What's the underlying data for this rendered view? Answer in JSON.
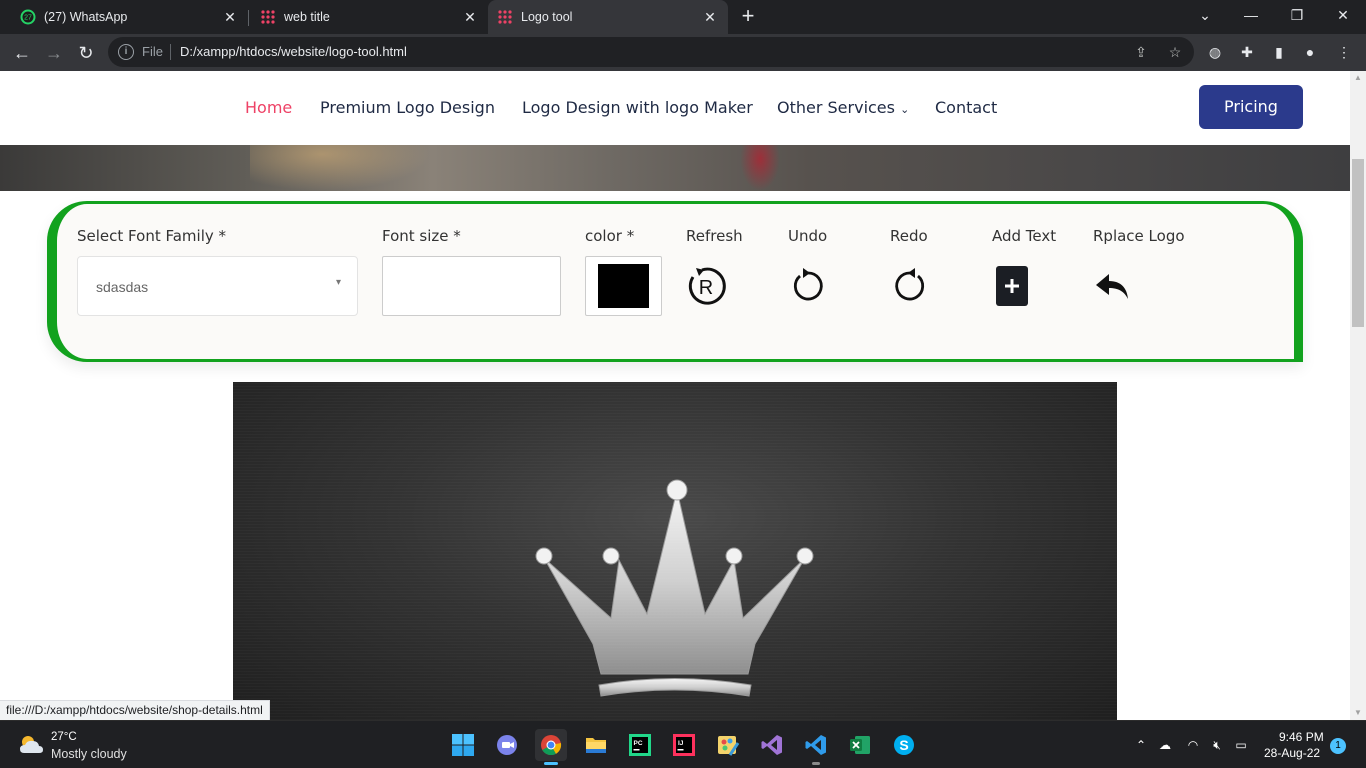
{
  "browser": {
    "tabs": [
      {
        "title": "(27) WhatsApp",
        "badge": "27",
        "active": false
      },
      {
        "title": "web title",
        "active": false
      },
      {
        "title": "Logo tool",
        "active": true
      }
    ],
    "omnibox": {
      "scheme_label": "File",
      "url": "D:/xampp/htdocs/website/logo-tool.html"
    },
    "status_url": "file:///D:/xampp/htdocs/website/shop-details.html"
  },
  "site_nav": {
    "links": [
      {
        "label": "Home",
        "active": true
      },
      {
        "label": "Premium Logo Design"
      },
      {
        "label": "Logo Design with logo Maker"
      },
      {
        "label": "Other Services",
        "has_dropdown": true
      },
      {
        "label": "Contact"
      }
    ],
    "cta": "Pricing",
    "active_color": "#ee4266",
    "cta_color": "#2b3a8c"
  },
  "tool_panel": {
    "border_color": "#12a21e",
    "font_family": {
      "label": "Select Font Family *",
      "value": "sdasdas"
    },
    "font_size": {
      "label": "Font size *",
      "value": ""
    },
    "color": {
      "label": "color *",
      "value": "#000000"
    },
    "actions": [
      {
        "label": "Refresh",
        "icon": "refresh-r-icon"
      },
      {
        "label": "Undo",
        "icon": "undo-icon"
      },
      {
        "label": "Redo",
        "icon": "redo-icon"
      },
      {
        "label": "Add Text",
        "icon": "plus-square-icon"
      },
      {
        "label": "Rplace Logo",
        "icon": "reply-arrow-icon"
      }
    ]
  },
  "canvas": {
    "logo": "crown-logo"
  },
  "taskbar": {
    "weather": {
      "temp": "27°C",
      "desc": "Mostly cloudy"
    },
    "clock": {
      "time": "9:46 PM",
      "date": "28-Aug-22"
    },
    "notifications": "1",
    "apps": [
      "windows-start-icon",
      "teams-chat-icon",
      "chrome-icon",
      "file-explorer-icon",
      "pycharm-icon",
      "intellij-icon",
      "paint-icon",
      "visual-studio-icon",
      "vscode-icon",
      "excel-icon",
      "skype-icon"
    ]
  }
}
